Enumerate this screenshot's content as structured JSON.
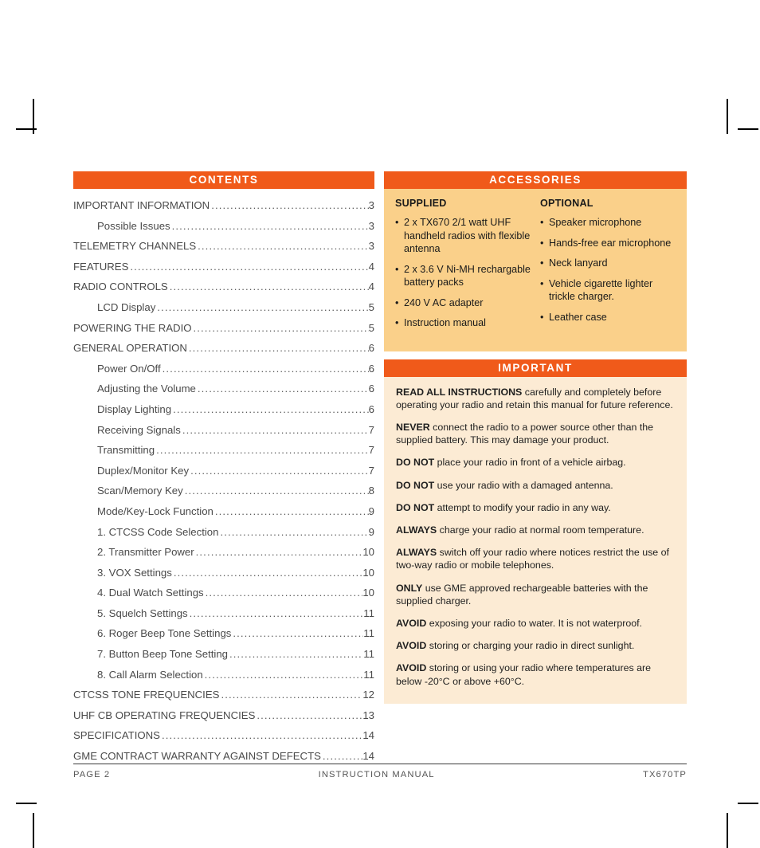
{
  "document": {
    "product_code": "TX670TP"
  },
  "contents": {
    "header": "CONTENTS",
    "entries": [
      {
        "label": "IMPORTANT INFORMATION",
        "page": "3",
        "level": 1
      },
      {
        "label": "Possible Issues",
        "page": "3",
        "level": 2
      },
      {
        "label": "TELEMETRY CHANNELS",
        "page": "3",
        "level": 1
      },
      {
        "label": "FEATURES",
        "page": "4",
        "level": 1
      },
      {
        "label": "RADIO CONTROLS",
        "page": "4",
        "level": 1
      },
      {
        "label": "LCD Display ",
        "page": "5",
        "level": 2
      },
      {
        "label": "POWERING THE RADIO ",
        "page": "5",
        "level": 1
      },
      {
        "label": "GENERAL OPERATION",
        "page": "6",
        "level": 1
      },
      {
        "label": "Power On/Off ",
        "page": "6",
        "level": 2
      },
      {
        "label": "Adjusting the Volume ",
        "page": "6",
        "level": 2
      },
      {
        "label": "Display Lighting",
        "page": "6",
        "level": 2
      },
      {
        "label": "Receiving Signals",
        "page": "7",
        "level": 2
      },
      {
        "label": "Transmitting ",
        "page": "7",
        "level": 2
      },
      {
        "label": "Duplex/Monitor Key",
        "page": "7",
        "level": 2
      },
      {
        "label": "Scan/Memory Key  ",
        "page": "8",
        "level": 2
      },
      {
        "label": "Mode/Key-Lock Function",
        "page": "9",
        "level": 2
      },
      {
        "label": "1. CTCSS Code Selection",
        "page": "9",
        "level": 2
      },
      {
        "label": "2. Transmitter Power ",
        "page": "10",
        "level": 2
      },
      {
        "label": "3. VOX Settings ",
        "page": "10",
        "level": 2
      },
      {
        "label": "4. Dual Watch Settings",
        "page": "10",
        "level": 2
      },
      {
        "label": "5. Squelch Settings ",
        "page": "11",
        "level": 2
      },
      {
        "label": "6. Roger Beep Tone Settings ",
        "page": "11",
        "level": 2
      },
      {
        "label": "7. Button Beep Tone Setting",
        "page": "11",
        "level": 2
      },
      {
        "label": "8. Call Alarm Selection  ",
        "page": "11",
        "level": 2
      },
      {
        "label": "CTCSS TONE FREQUENCIES ",
        "page": "12",
        "level": 1
      },
      {
        "label": "UHF CB OPERATING FREQUENCIES ",
        "page": "13",
        "level": 1
      },
      {
        "label": "SPECIFICATIONS ",
        "page": "14",
        "level": 1
      },
      {
        "label": "GME CONTRACT WARRANTY AGAINST DEFECTS",
        "page": "14",
        "level": 1
      }
    ]
  },
  "accessories": {
    "header": "ACCESSORIES",
    "supplied": {
      "heading": "SUPPLIED",
      "items": [
        "2 x TX670 2/1 watt UHF handheld radios with flexible antenna",
        "2 x 3.6 V Ni-MH rechargable battery packs",
        "240 V AC adapter",
        "Instruction manual"
      ]
    },
    "optional": {
      "heading": "OPTIONAL",
      "items": [
        "Speaker microphone",
        "Hands-free ear microphone",
        "Neck lanyard",
        "Vehicle cigarette lighter trickle charger.",
        "Leather case"
      ]
    }
  },
  "important": {
    "header": "IMPORTANT",
    "items": [
      {
        "lead": "READ ALL INSTRUCTIONS",
        "text": " carefully and completely before operating your radio and retain this manual for future reference."
      },
      {
        "lead": "NEVER",
        "text": " connect the radio to a power source other than the supplied battery. This may damage your product."
      },
      {
        "lead": "DO NOT",
        "text": " place your radio in front of a vehicle airbag."
      },
      {
        "lead": "DO NOT",
        "text": " use your radio with a damaged antenna."
      },
      {
        "lead": "DO NOT",
        "text": " attempt to modify your radio in any way."
      },
      {
        "lead": "ALWAYS",
        "text": " charge your radio at normal room temperature."
      },
      {
        "lead": "ALWAYS",
        "text": " switch off your radio where notices restrict the use of two-way radio or mobile telephones."
      },
      {
        "lead": "ONLY",
        "text": " use GME approved rechargeable batteries with the supplied charger."
      },
      {
        "lead": "AVOID",
        "text": " exposing your radio to water. It is not waterproof."
      },
      {
        "lead": "AVOID",
        "text": " storing or charging your radio in direct sunlight."
      },
      {
        "lead": "AVOID",
        "text": " storing or using your radio where temperatures are below -20°C or above +60°C."
      }
    ]
  },
  "footer": {
    "left": "PAGE 2",
    "center": "INSTRUCTION MANUAL",
    "right": "TX670TP"
  },
  "colors": {
    "accent_orange": "#F05A1A",
    "accessories_bg": "#FAD08A",
    "important_bg": "#FCEBD4",
    "body_text": "#3a3a3a"
  }
}
